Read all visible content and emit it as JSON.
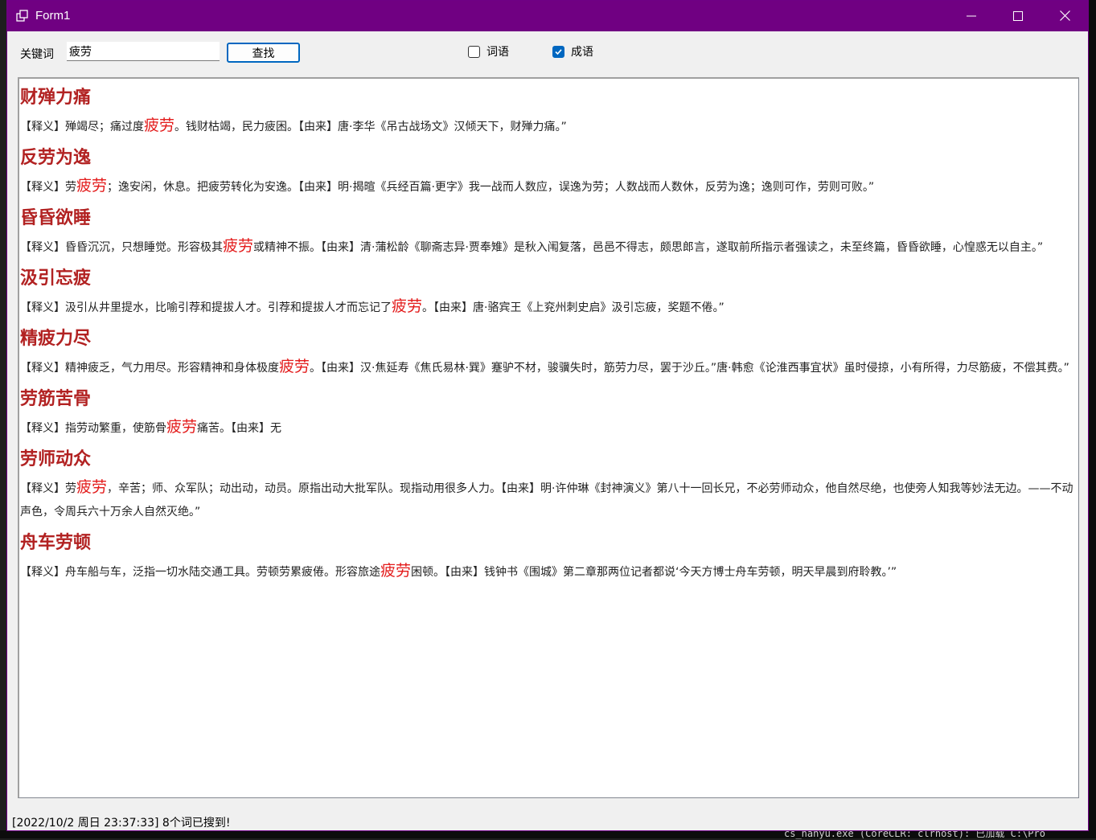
{
  "window": {
    "title": "Form1"
  },
  "toolbar": {
    "keyword_label": "关键词",
    "search_value": "疲劳",
    "find_label": "查找",
    "checkbox_ciyu": {
      "label": "词语",
      "checked": false
    },
    "checkbox_chengyu": {
      "label": "成语",
      "checked": true
    }
  },
  "entries": [
    {
      "title": "财殚力痛",
      "before": "【释义】殚竭尽；痛过度",
      "hl": "疲劳",
      "after": "。钱财枯竭，民力疲困。【由来】唐·李华《吊古战场文》汉倾天下，财殚力痛。”"
    },
    {
      "title": "反劳为逸",
      "before": "【释义】劳",
      "hl": "疲劳",
      "after": "；逸安闲，休息。把疲劳转化为安逸。【由来】明·揭暄《兵经百篇·更字》我一战而人数应，误逸为劳；人数战而人数休，反劳为逸；逸则可作，劳则可败。”"
    },
    {
      "title": "昏昏欲睡",
      "before": "【释义】昏昏沉沉，只想睡觉。形容极其",
      "hl": "疲劳",
      "after": "或精神不振。【由来】清·蒲松龄《聊斋志异·贾奉雉》是秋入闱复落，邑邑不得志，颇思郎言，遂取前所指示者强读之，未至终篇，昏昏欲睡，心惶惑无以自主。”"
    },
    {
      "title": "汲引忘疲",
      "before": "【释义】汲引从井里提水，比喻引荐和提拔人才。引荐和提拔人才而忘记了",
      "hl": "疲劳",
      "after": "。【由来】唐·骆宾王《上兖州刺史启》汲引忘疲，奖题不倦。”"
    },
    {
      "title": "精疲力尽",
      "before": "【释义】精神疲乏，气力用尽。形容精神和身体极度",
      "hl": "疲劳",
      "after": "。【由来】汉·焦延寿《焦氏易林·巽》蹇驴不材，骏骥失时，筋劳力尽，罢于沙丘。”唐·韩愈《论淮西事宜状》虽时侵掠，小有所得，力尽筋疲，不偿其费。”"
    },
    {
      "title": "劳筋苦骨",
      "before": "【释义】指劳动繁重，使筋骨",
      "hl": "疲劳",
      "after": "痛苦。【由来】无"
    },
    {
      "title": "劳师动众",
      "before": "【释义】劳",
      "hl": "疲劳",
      "after": "，辛苦；师、众军队；动出动，动员。原指出动大批军队。现指动用很多人力。【由来】明·许仲琳《封神演义》第八十一回长兄，不必劳师动众，他自然尽绝，也使旁人知我等妙法无边。——不动声色，令周兵六十万余人自然灭绝。”"
    },
    {
      "title": "舟车劳顿",
      "before": "【释义】舟车船与车，泛指一切水陆交通工具。劳顿劳累疲倦。形容旅途",
      "hl": "疲劳",
      "after": "困顿。【由来】钱钟书《围城》第二章那两位记者都说‘今天方博士舟车劳顿，明天早晨到府聆教。’”"
    }
  ],
  "status": "[2022/10/2 周日 23:37:33] 8个词已搜到!",
  "background_terminal": "cs_hanyu.exe  (CoreCLR: clrhost): 已加载  C:\\Pro",
  "colors": {
    "titlebar": "#700082",
    "entry_title": "#b22222",
    "highlight": "#e31b1b",
    "accent": "#0067c0"
  },
  "icons": [
    "app-icon",
    "minimize-icon",
    "maximize-icon",
    "close-icon",
    "checkmark-icon"
  ]
}
